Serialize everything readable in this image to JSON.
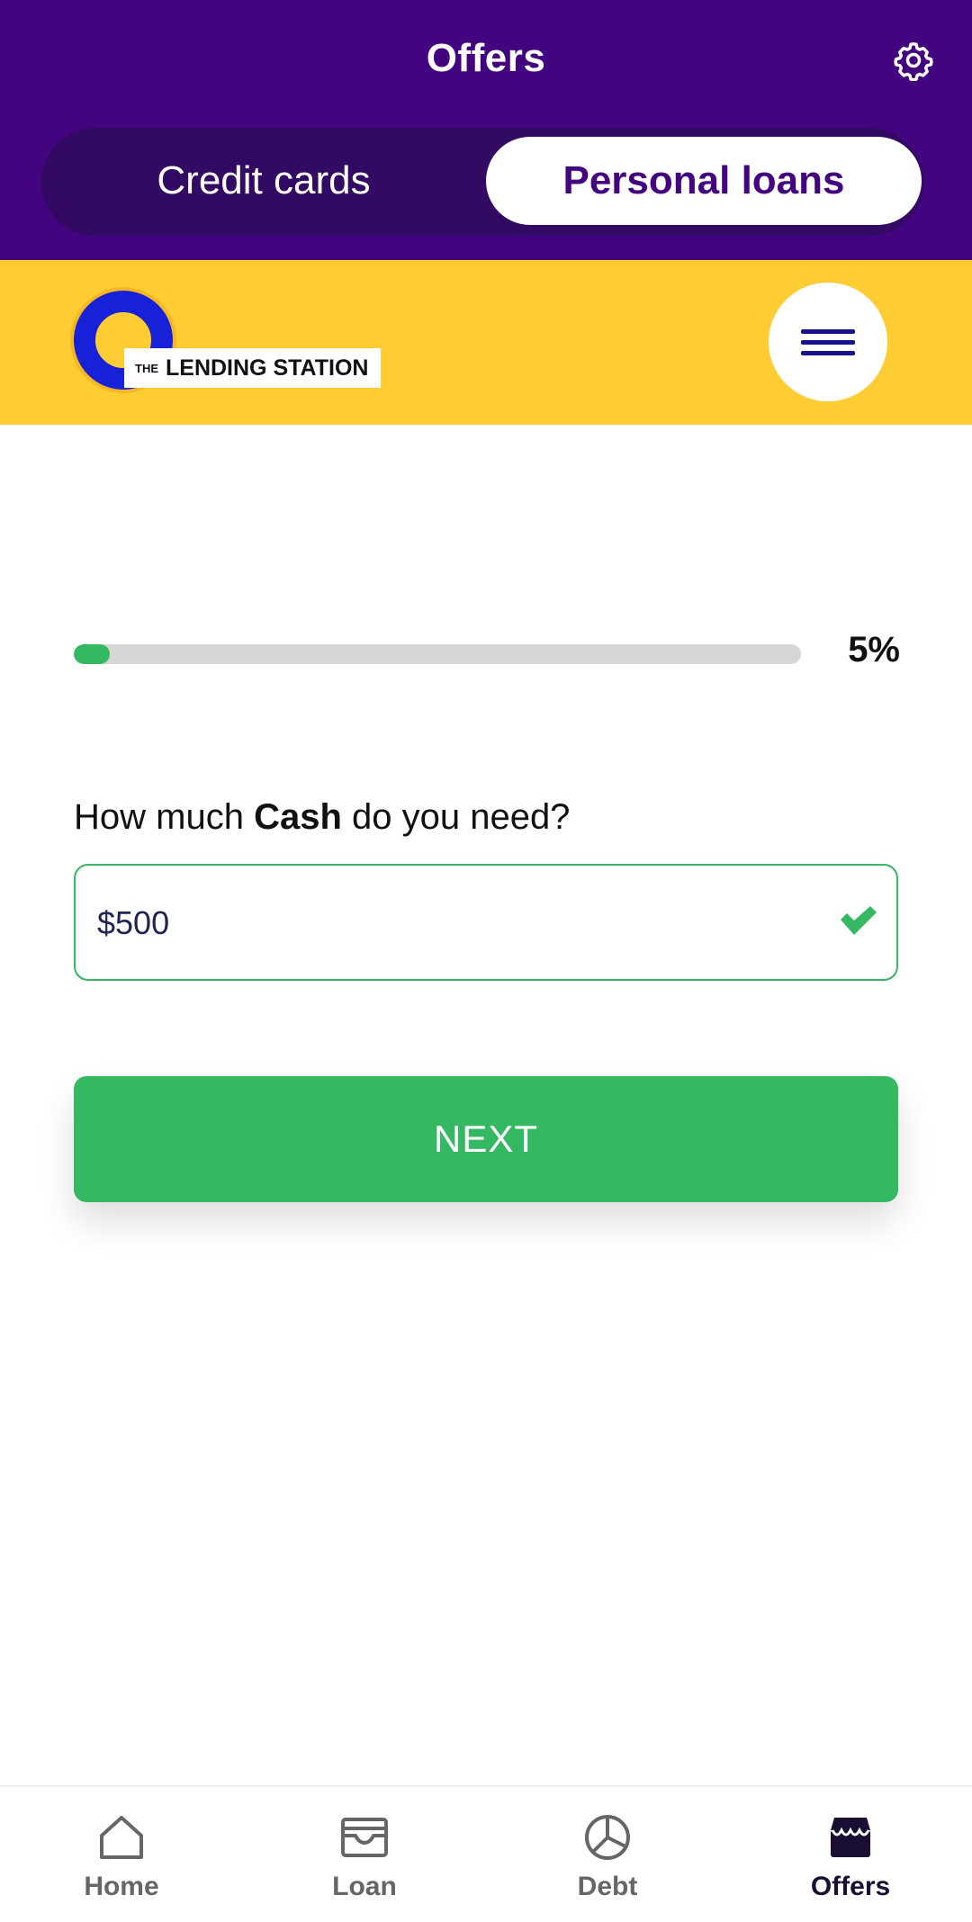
{
  "header": {
    "title": "Offers",
    "settings_icon": "gear-icon"
  },
  "tabs": [
    {
      "label": "Credit cards",
      "selected": false
    },
    {
      "label": "Personal loans",
      "selected": true
    }
  ],
  "brand": {
    "logo_text_small": "THE",
    "logo_text": "LENDING STATION",
    "menu_icon": "hamburger-menu-icon",
    "colors": {
      "brand_bar": "#ffcd33",
      "logo_ring": "#1722d8",
      "header": "#43047f"
    }
  },
  "progress": {
    "label": "5%",
    "value": 0.05,
    "color": "#35b862"
  },
  "question": {
    "prefix": "How much ",
    "bold": "Cash",
    "suffix": " do you need?"
  },
  "cash_field": {
    "value": "$500",
    "status_icon": "checkmark-icon"
  },
  "next_button": {
    "label": "NEXT",
    "color": "#35b862"
  },
  "bottom_nav": [
    {
      "label": "Home",
      "icon": "home-icon",
      "active": false
    },
    {
      "label": "Loan",
      "icon": "wallet-icon",
      "active": false
    },
    {
      "label": "Debt",
      "icon": "pie-chart-icon",
      "active": false
    },
    {
      "label": "Offers",
      "icon": "store-icon",
      "active": true
    }
  ]
}
